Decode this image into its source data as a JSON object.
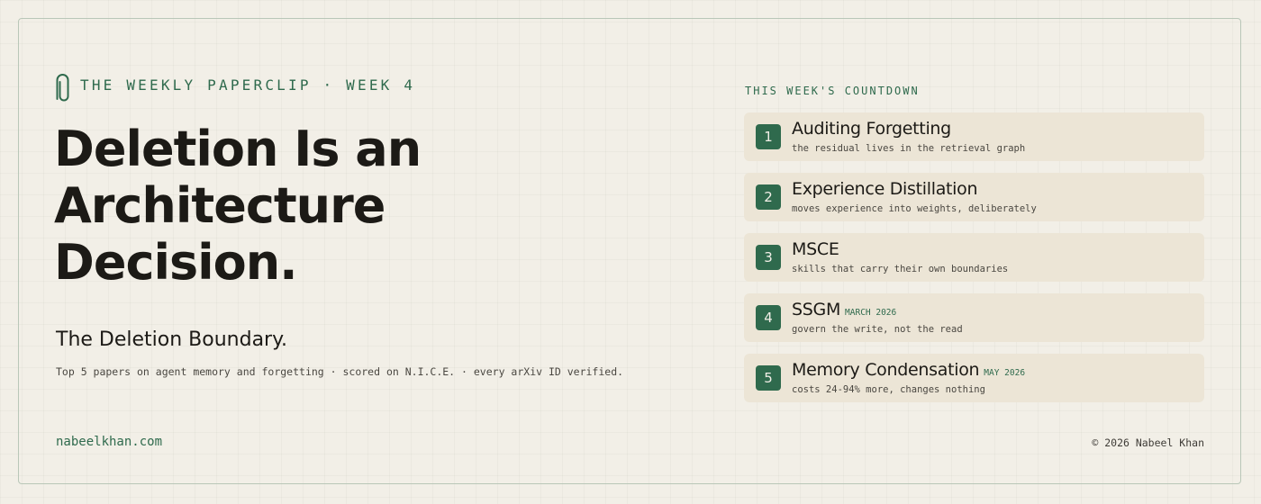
{
  "brand": {
    "label": "THE WEEKLY PAPERCLIP · WEEK 4",
    "icon": "paperclip-icon",
    "accent_color": "#2f6a4d"
  },
  "headline": {
    "lines": [
      "Deletion Is an",
      "Architecture",
      "Decision."
    ]
  },
  "subtitle": "The Deletion Boundary.",
  "description": "Top 5 papers on agent memory and forgetting · scored on N.I.C.E. · every arXiv ID verified.",
  "countdown": {
    "heading": "THIS WEEK'S COUNTDOWN",
    "items": [
      {
        "rank": "1",
        "title": "Auditing Forgetting",
        "date": "",
        "subtitle": "the residual lives in the retrieval graph"
      },
      {
        "rank": "2",
        "title": "Experience Distillation",
        "date": "",
        "subtitle": "moves experience into weights, deliberately"
      },
      {
        "rank": "3",
        "title": "MSCE",
        "date": "",
        "subtitle": "skills that carry their own boundaries"
      },
      {
        "rank": "4",
        "title": "SSGM",
        "date": "MARCH 2026",
        "subtitle": "govern the write, not the read"
      },
      {
        "rank": "5",
        "title": "Memory Condensation",
        "date": "MAY 2026",
        "subtitle": "costs 24-94% more, changes nothing"
      }
    ]
  },
  "footer": {
    "site": "nabeelkhan.com",
    "copyright": "© 2026 Nabeel Khan"
  },
  "colors": {
    "background": "#f2efe7",
    "card": "#ece5d6",
    "accent": "#2f6a4d",
    "text": "#1c1a16"
  }
}
